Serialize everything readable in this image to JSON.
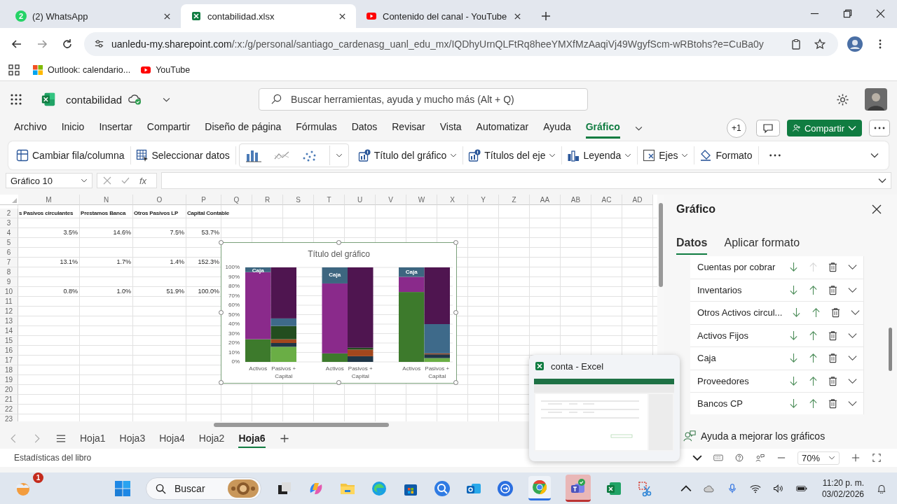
{
  "browser": {
    "tabs": [
      {
        "title": "(2) WhatsApp",
        "badge": "2",
        "selected": false
      },
      {
        "title": "contabilidad.xlsx",
        "selected": true
      },
      {
        "title": "Contenido del canal - YouTube",
        "selected": false
      }
    ],
    "url_host": "uanledu-my.sharepoint.com",
    "url_path": "/:x:/g/personal/santiago_cardenasg_uanl_edu_mx/IQDhyUrnQLFtRq8heeYMXfMzAaqiVj49WgyfScm-wRBtohs?e=CuBa0y",
    "bookmarks": [
      {
        "label": "Outlook: calendario..."
      },
      {
        "label": "YouTube"
      }
    ]
  },
  "app": {
    "file_name": "contabilidad",
    "search": {
      "placeholder": "Buscar herramientas, ayuda y mucho más (Alt + Q)"
    },
    "ribbon_tabs": [
      {
        "label": "Archivo",
        "selected": false
      },
      {
        "label": "Inicio",
        "selected": false
      },
      {
        "label": "Insertar",
        "selected": false
      },
      {
        "label": "Compartir",
        "selected": false
      },
      {
        "label": "Diseño de página",
        "selected": false
      },
      {
        "label": "Fórmulas",
        "selected": false
      },
      {
        "label": "Datos",
        "selected": false
      },
      {
        "label": "Revisar",
        "selected": false
      },
      {
        "label": "Vista",
        "selected": false
      },
      {
        "label": "Automatizar",
        "selected": false
      },
      {
        "label": "Ayuda",
        "selected": false
      },
      {
        "label": "Gráfico",
        "selected": true
      }
    ],
    "presence": "+1",
    "share": "Compartir",
    "toolbar": [
      {
        "label": "Cambiar fila/columna",
        "kind": "button"
      },
      {
        "label": "Seleccionar datos",
        "kind": "button"
      },
      {
        "kind": "chart_types"
      },
      {
        "label": "Título del gráfico",
        "kind": "dropdown"
      },
      {
        "label": "Títulos del eje",
        "kind": "dropdown"
      },
      {
        "label": "Leyenda",
        "kind": "dropdown"
      },
      {
        "label": "Ejes",
        "kind": "dropdown"
      },
      {
        "label": "Formato",
        "kind": "button"
      }
    ],
    "name_box": "Gráfico 10",
    "fx": "fx"
  },
  "sheet": {
    "columns": [
      "M",
      "N",
      "O",
      "P",
      "Q",
      "R",
      "S",
      "T",
      "U",
      "V",
      "W",
      "X",
      "Y",
      "Z",
      "AA",
      "AB",
      "AC",
      "AD"
    ],
    "rows": [
      {
        "number": "2",
        "kind": "header",
        "cells": [
          "s Pasivos circulantes",
          "Prestamos Banca",
          "Otros Pasivos LP",
          "Capital Contable"
        ]
      },
      {
        "number": "3"
      },
      {
        "number": "4",
        "kind": "values",
        "cells": [
          "3.5%",
          "14.6%",
          "7.5%",
          "53.7%"
        ]
      },
      {
        "number": "5"
      },
      {
        "number": "6"
      },
      {
        "number": "7",
        "kind": "values",
        "cells": [
          "13.1%",
          "1.7%",
          "1.4%",
          "152.3%"
        ]
      },
      {
        "number": "8"
      },
      {
        "number": "9"
      },
      {
        "number": "10",
        "kind": "values",
        "cells": [
          "0.8%",
          "1.0%",
          "51.9%",
          "100.0%"
        ]
      },
      {
        "number": "11"
      },
      {
        "number": "12"
      },
      {
        "number": "13"
      },
      {
        "number": "14"
      },
      {
        "number": "15"
      },
      {
        "number": "16"
      },
      {
        "number": "17"
      },
      {
        "number": "18"
      },
      {
        "number": "19"
      },
      {
        "number": "20"
      },
      {
        "number": "21"
      },
      {
        "number": "22"
      },
      {
        "number": "23"
      }
    ],
    "chart": {
      "chart_data": {
        "type": "bar",
        "stacked": true,
        "grid": true,
        "title": "Título del gráfico",
        "categories": [
          "Activos",
          "Pasivos + Capital",
          null,
          "Activos",
          "Pasivos + Capital",
          null,
          "Activos",
          "Pasivos + Capital"
        ],
        "ylim": [
          0,
          100
        ],
        "yticks": [
          {
            "value": 0,
            "label": "0%"
          },
          {
            "value": 10,
            "label": "10%"
          },
          {
            "value": 20,
            "label": "20%"
          },
          {
            "value": 30,
            "label": "30%"
          },
          {
            "value": 40,
            "label": "40%"
          },
          {
            "value": 50,
            "label": "50%"
          },
          {
            "value": 60,
            "label": "60%"
          },
          {
            "value": 70,
            "label": "70%"
          },
          {
            "value": 80,
            "label": "80%"
          },
          {
            "value": 90,
            "label": "90%"
          },
          {
            "value": 100,
            "label": "100%"
          }
        ],
        "series": [
          {
            "color": "#3d7a2c",
            "values": [
              24,
              null,
              null,
              9,
              null,
              null,
              74,
              null
            ]
          },
          {
            "color": "#8a2a8b",
            "values": [
              71,
              null,
              null,
              74,
              null,
              null,
              16,
              null
            ]
          },
          {
            "color": "#3d6680",
            "values": [
              5,
              null,
              null,
              17,
              null,
              null,
              10,
              null
            ]
          },
          {
            "color": "#6aae45",
            "values": [
              null,
              16,
              null,
              null,
              0,
              null,
              null,
              4
            ]
          },
          {
            "color": "#1f3647",
            "values": [
              null,
              4,
              null,
              null,
              6,
              null,
              null,
              4
            ]
          },
          {
            "color": "#a2471d",
            "values": [
              null,
              4,
              null,
              null,
              7,
              null,
              null,
              1
            ]
          },
          {
            "color": "#234d1f",
            "values": [
              null,
              14,
              null,
              null,
              2,
              null,
              null,
              0
            ]
          },
          {
            "color": "#3e6a8a",
            "values": [
              null,
              8,
              null,
              null,
              0,
              null,
              null,
              31
            ]
          },
          {
            "color": "#4f1550",
            "values": [
              null,
              54,
              null,
              null,
              85,
              null,
              null,
              60
            ]
          }
        ],
        "annotations": [
          "Caja",
          "Caja",
          "Caja"
        ]
      }
    },
    "sheet_tabs": [
      {
        "label": "Hoja1",
        "selected": false
      },
      {
        "label": "Hoja3",
        "selected": false
      },
      {
        "label": "Hoja4",
        "selected": false
      },
      {
        "label": "Hoja2",
        "selected": false
      },
      {
        "label": "Hoja6",
        "selected": true
      }
    ],
    "status": "Estadísticas del libro",
    "zoom": "70%"
  },
  "panel": {
    "title": "Gráfico",
    "tabs": [
      {
        "label": "Datos",
        "selected": true
      },
      {
        "label": "Aplicar formato",
        "selected": false
      }
    ],
    "series": [
      {
        "name": "Cuentas por cobrar",
        "up_disabled": true
      },
      {
        "name": "Inventarios",
        "up_disabled": false
      },
      {
        "name": "Otros Activos circul...",
        "up_disabled": false
      },
      {
        "name": "Activos Fijos",
        "up_disabled": false
      },
      {
        "name": "Caja",
        "up_disabled": false
      },
      {
        "name": "Proveedores",
        "up_disabled": false
      },
      {
        "name": "Bancos CP",
        "up_disabled": false
      }
    ],
    "feedback": "Ayuda a mejorar los gráficos"
  },
  "preview": {
    "title": "conta - Excel"
  },
  "taskbar": {
    "weather_badge": "1",
    "search": {
      "placeholder": "Buscar"
    },
    "time": "11:20 p. m.",
    "date": "03/02/2026"
  }
}
